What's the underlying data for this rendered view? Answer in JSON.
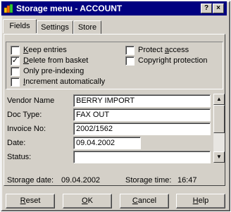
{
  "window": {
    "title": "Storage menu - ACCOUNT",
    "help_button": "?",
    "close_button": "×"
  },
  "tabs": [
    {
      "label": "Fields",
      "active": true
    },
    {
      "label": "Settings",
      "active": false
    },
    {
      "label": "Store",
      "active": false
    }
  ],
  "options": {
    "keep_entries": {
      "label_u": "K",
      "label_rest": "eep entries",
      "checked": false
    },
    "delete_from_basket": {
      "label_u": "D",
      "label_rest": "elete from basket",
      "checked": true
    },
    "only_pre_indexing": {
      "label_u": "",
      "label_rest": "Only pre-indexing",
      "checked": false
    },
    "increment_automatically": {
      "label_u": "I",
      "label_rest": "ncrement automatically",
      "checked": false
    },
    "protect_access": {
      "label_pre": "Protect ",
      "label_u": "a",
      "label_rest": "ccess",
      "checked": false
    },
    "copyright_protection": {
      "label_u": "",
      "label_rest": "Copyright protection",
      "checked": false
    }
  },
  "fields": [
    {
      "label": "Vendor Name",
      "value": "BERRY IMPORT"
    },
    {
      "label": "Doc Type:",
      "value": "FAX OUT"
    },
    {
      "label": "Invoice No:",
      "value": "2002/1562"
    },
    {
      "label": "Date:",
      "value": "09.04.2002"
    },
    {
      "label": "Status:",
      "value": ""
    }
  ],
  "info": {
    "storage_date_label": "Storage date:",
    "storage_date_value": "09.04.2002",
    "storage_time_label": "Storage time:",
    "storage_time_value": "16:47"
  },
  "buttons": {
    "reset": {
      "u": "R",
      "rest": "eset"
    },
    "ok": {
      "u": "O",
      "rest": "K"
    },
    "cancel": {
      "u": "C",
      "rest": "ancel"
    },
    "help": {
      "u": "H",
      "rest": "elp"
    }
  },
  "icons": {
    "app": "app-icon",
    "scroll_up": "▲",
    "scroll_down": "▼"
  },
  "colors": {
    "titlebar": "#000080",
    "face": "#d4d0c8"
  }
}
